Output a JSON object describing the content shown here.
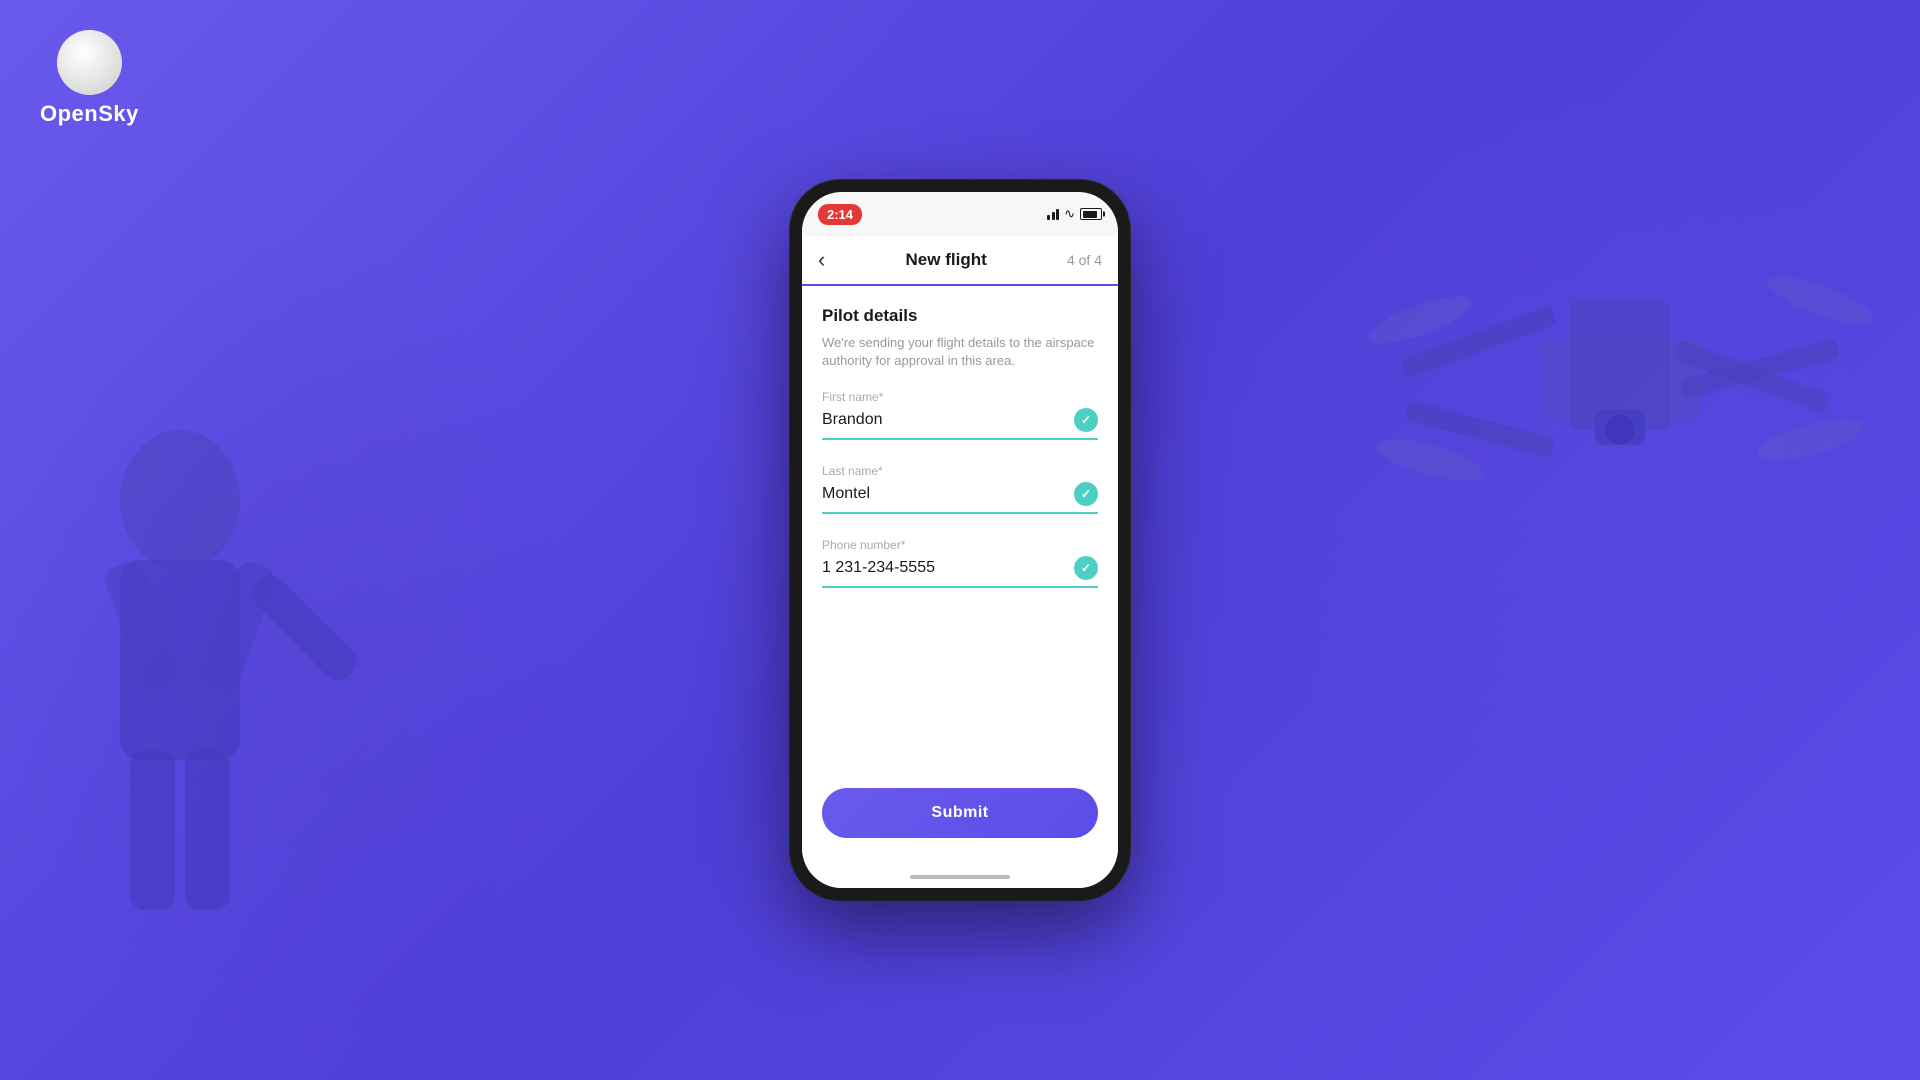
{
  "brand": {
    "name": "OpenSky"
  },
  "statusBar": {
    "time": "2:14",
    "batteryLevel": "85%"
  },
  "header": {
    "backLabel": "‹",
    "title": "New flight",
    "step": "4 of 4"
  },
  "form": {
    "sectionTitle": "Pilot details",
    "sectionDesc": "We're sending your flight details to the airspace authority for approval in this area.",
    "fields": [
      {
        "label": "First name*",
        "value": "Brandon",
        "valid": true
      },
      {
        "label": "Last name*",
        "value": "Montel",
        "valid": true
      },
      {
        "label": "Phone number*",
        "value": "1 231-234-5555",
        "valid": true
      }
    ]
  },
  "submitButton": {
    "label": "Submit"
  },
  "colors": {
    "accent": "#5b4de8",
    "teal": "#4dd0c4",
    "statusRed": "#e53935",
    "background": "#5b4de8"
  }
}
